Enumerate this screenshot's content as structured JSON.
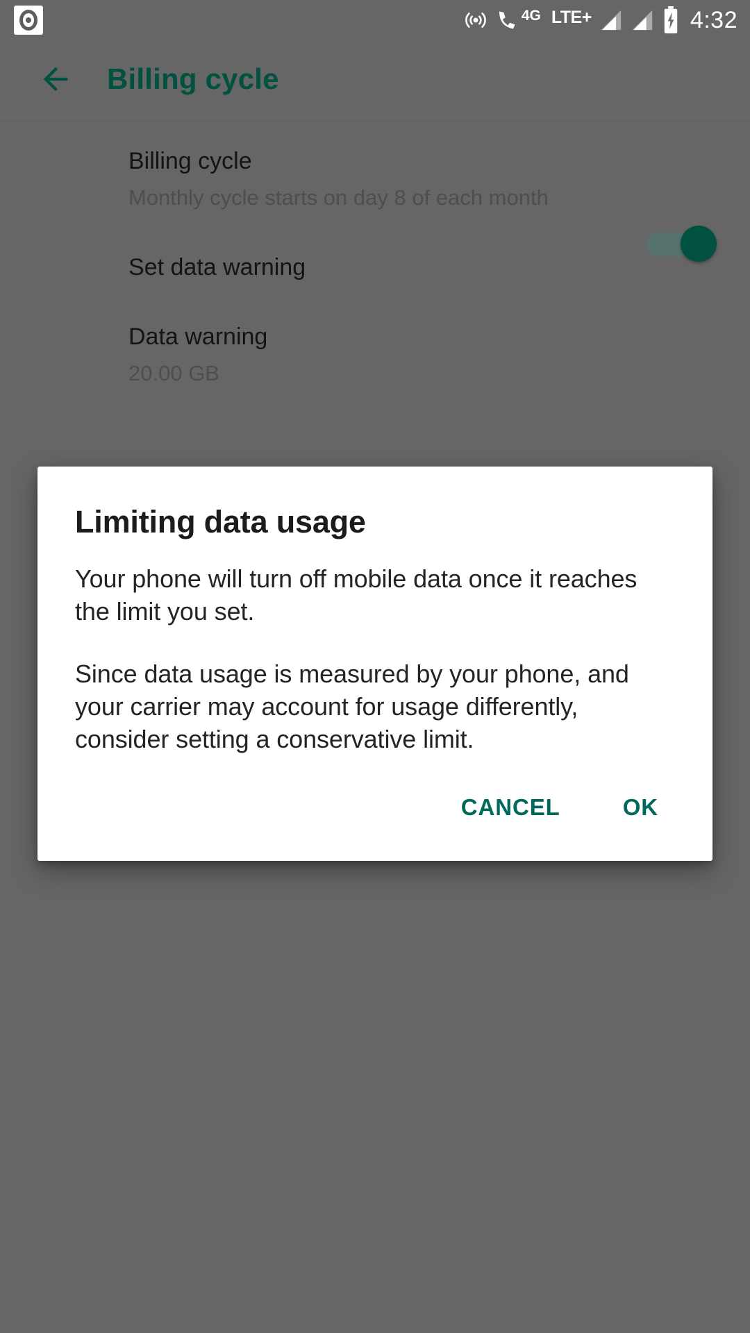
{
  "statusbar": {
    "time": "4:32",
    "network_label": "LTE+",
    "call_network_label": "4G",
    "icons": [
      "media-player-icon",
      "hotspot-icon",
      "phone-4g-icon",
      "signal-bars-1-icon",
      "signal-bars-2-icon",
      "battery-charging-icon"
    ]
  },
  "appbar": {
    "title": "Billing cycle",
    "back_label": "Navigate up"
  },
  "settings": {
    "rows": [
      {
        "title": "Billing cycle",
        "subtitle": "Monthly cycle starts on day 8 of each month",
        "control": "none"
      },
      {
        "title": "Set data warning",
        "subtitle": "",
        "control": "switch",
        "switch_on": true
      },
      {
        "title": "Data warning",
        "subtitle": "20.00 GB",
        "control": "none"
      }
    ]
  },
  "dialog": {
    "title": "Limiting data usage",
    "paragraphs": [
      "Your phone will turn off mobile data once it reaches the limit you set.",
      "Since data usage is measured by your phone, and your carrier may account for usage differently, consider setting a conservative limit."
    ],
    "cancel_label": "CANCEL",
    "ok_label": "OK"
  },
  "colors": {
    "accent": "#00695c",
    "appbar_title": "#00513f",
    "switch_on": "#00513f",
    "scrim_background": "#666666",
    "dialog_background": "#ffffff"
  }
}
